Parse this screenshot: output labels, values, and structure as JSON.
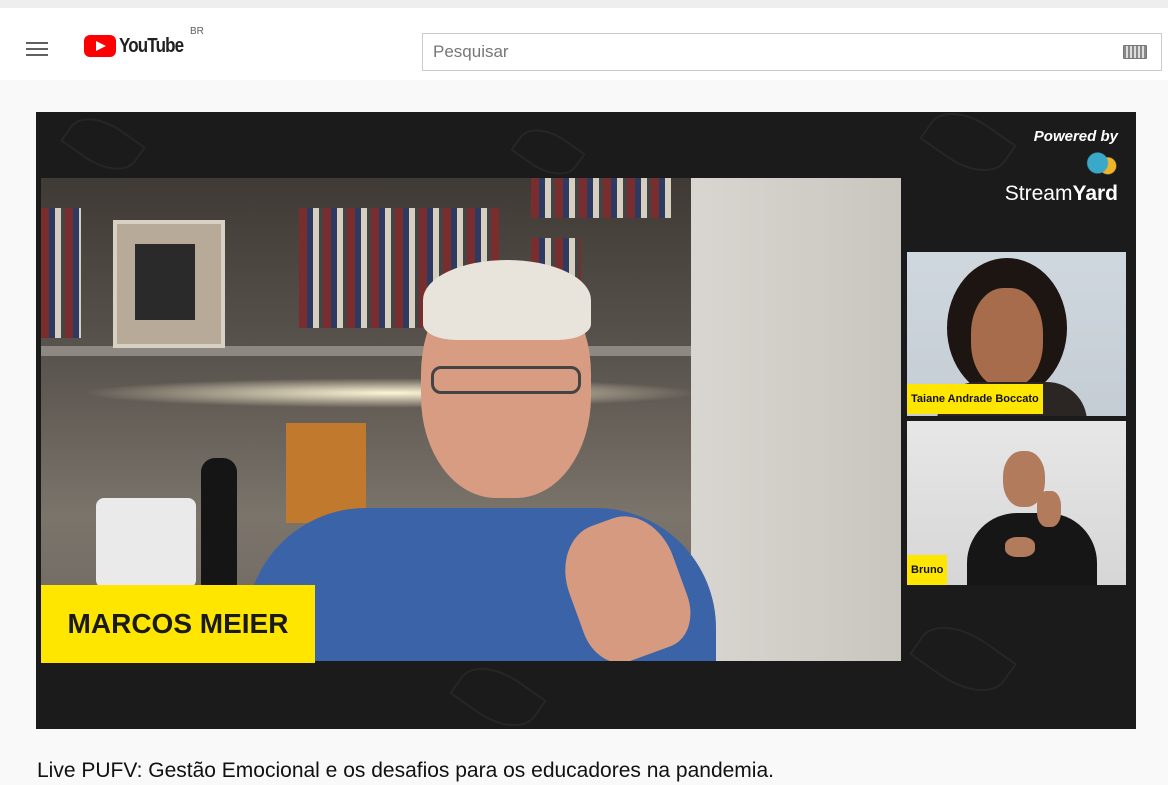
{
  "header": {
    "logo_text": "YouTube",
    "country_code": "BR",
    "search_placeholder": "Pesquisar"
  },
  "video": {
    "powered_by": "Powered by",
    "brand_stream": "Stream",
    "brand_yard": "Yard",
    "main_speaker_name": "MARCOS MEIER",
    "participants": [
      {
        "name": "Taiane Andrade Boccato"
      },
      {
        "name": "Bruno"
      }
    ],
    "title": "Live PUFV: Gestão Emocional e os desafios para os educadores na pandemia."
  },
  "colors": {
    "youtube_red": "#ff0000",
    "name_tag_yellow": "#ffe600",
    "player_background": "#1b1b1b"
  }
}
